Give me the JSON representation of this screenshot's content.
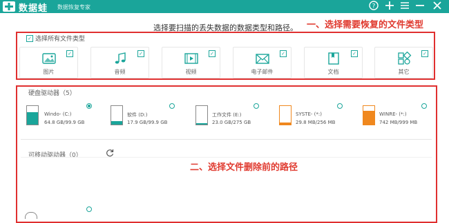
{
  "app": {
    "name": "数据蛙",
    "subtitle": "数据恢复专家",
    "accent_color": "#1aa59a",
    "toolbar_icons": [
      "help-icon",
      "add-icon",
      "menu-icon",
      "minimize-icon",
      "close-icon"
    ]
  },
  "instruction": "选择要扫描的丢失数据的数据类型和路径。",
  "annotations": {
    "step1": "一、选择需要恢复的文件类型",
    "step2": "二、选择文件删除前的路径",
    "color": "#e03a2f"
  },
  "file_types": {
    "select_all_label": "选择所有文件类型",
    "items": [
      {
        "label": "图片",
        "icon": "image-icon",
        "checked": true
      },
      {
        "label": "音频",
        "icon": "music-icon",
        "checked": true
      },
      {
        "label": "视频",
        "icon": "video-icon",
        "checked": true
      },
      {
        "label": "电子邮件",
        "icon": "email-icon",
        "checked": true
      },
      {
        "label": "文档",
        "icon": "document-icon",
        "checked": true
      },
      {
        "label": "其它",
        "icon": "other-icon",
        "checked": true
      }
    ]
  },
  "hard_drives": {
    "title": "硬盘驱动器（5）",
    "drives": [
      {
        "name": "Windo- (C:)",
        "size": "64.8 GB/99.9 GB",
        "usage": 0.65,
        "fill_color": "#1aa59a",
        "selected": true
      },
      {
        "name": "软件 (D:)",
        "size": "17.9 GB/99.9 GB",
        "usage": 0.18,
        "fill_color": "#1aa59a",
        "selected": false
      },
      {
        "name": "工作文件 (E:)",
        "size": "23.0 GB/275 GB",
        "usage": 0.08,
        "fill_color": "#1aa59a",
        "selected": false
      },
      {
        "name": "SYSTE- (*:)",
        "size": "29.8 MB/256 MB",
        "usage": 0.12,
        "fill_color": "#f0881e",
        "selected": false
      },
      {
        "name": "WINRE- (*:)",
        "size": "742 MB/999 MB",
        "usage": 0.74,
        "fill_color": "#f0881e",
        "selected": false
      }
    ]
  },
  "removable_drives": {
    "title": "可移动驱动器（0）"
  }
}
